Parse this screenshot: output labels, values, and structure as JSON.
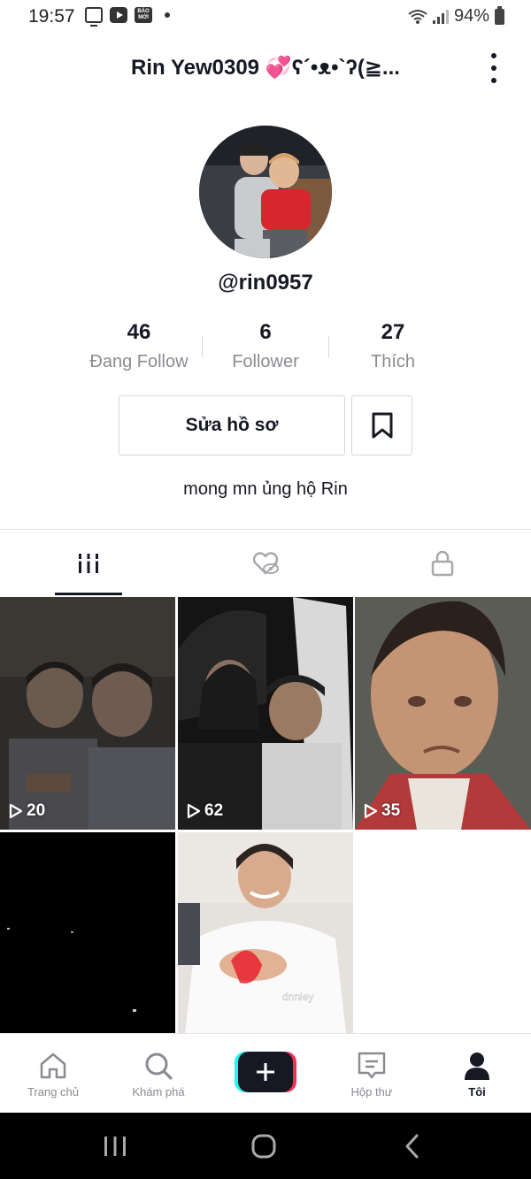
{
  "status_bar": {
    "time": "19:57",
    "mini_badge": "BÁO MỚI",
    "battery_text": "94%"
  },
  "header": {
    "profile_name": "Rin Yew0309 💞ʕ´•ᴥ•`ʔ(≧..."
  },
  "profile": {
    "username": "@rin0957",
    "bio": "mong mn ủng hộ Rin"
  },
  "stats": {
    "following": {
      "value": "46",
      "label": "Đang Follow"
    },
    "followers": {
      "value": "6",
      "label": "Follower"
    },
    "likes": {
      "value": "27",
      "label": "Thích"
    }
  },
  "actions": {
    "edit_profile_label": "Sửa hồ sơ"
  },
  "videos": [
    {
      "views": "20"
    },
    {
      "views": "62"
    },
    {
      "views": "35"
    },
    {
      "views": ""
    },
    {
      "views": ""
    }
  ],
  "thumbnail_watermark": "dnniey",
  "bottom_nav": {
    "home": "Trang chủ",
    "discover": "Khám phá",
    "inbox": "Hộp thư",
    "me": "Tôi"
  },
  "colors": {
    "accent_red": "#fe2c55",
    "accent_cyan": "#25f4ee",
    "text_primary": "#161823",
    "text_secondary": "#8a8b91"
  }
}
